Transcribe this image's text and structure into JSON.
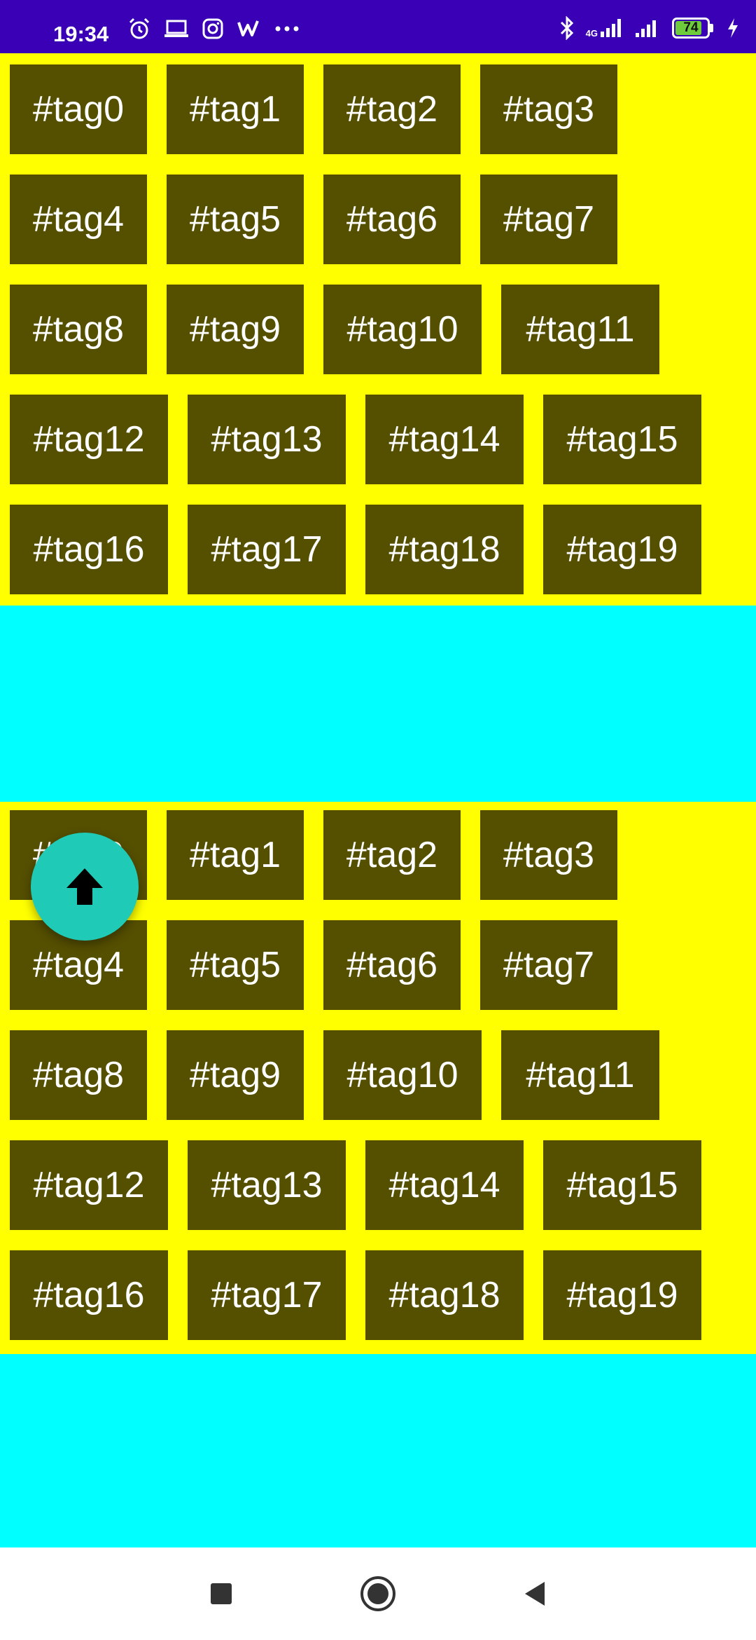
{
  "status_bar": {
    "time": "19:34",
    "left_icons": [
      "alarm-icon",
      "laptop-icon",
      "instagram-icon",
      "w-app-icon",
      "more-icon"
    ],
    "network_label": "4G",
    "battery_level": "74",
    "color": "#3a00b6"
  },
  "tag_blocks": [
    {
      "rows": [
        [
          "#tag0",
          "#tag1",
          "#tag2",
          "#tag3"
        ],
        [
          "#tag4",
          "#tag5",
          "#tag6",
          "#tag7"
        ],
        [
          "#tag8",
          "#tag9",
          "#tag10",
          "#tag11"
        ],
        [
          "#tag12",
          "#tag13",
          "#tag14",
          "#tag15"
        ],
        [
          "#tag16",
          "#tag17",
          "#tag18",
          "#tag19"
        ]
      ]
    },
    {
      "rows": [
        [
          "#tag0",
          "#tag1",
          "#tag2",
          "#tag3"
        ],
        [
          "#tag4",
          "#tag5",
          "#tag6",
          "#tag7"
        ],
        [
          "#tag8",
          "#tag9",
          "#tag10",
          "#tag11"
        ],
        [
          "#tag12",
          "#tag13",
          "#tag14",
          "#tag15"
        ],
        [
          "#tag16",
          "#tag17",
          "#tag18",
          "#tag19"
        ]
      ]
    }
  ],
  "colors": {
    "tag_background": "#554f00",
    "block_background": "#ffff00",
    "band_background": "#00ffff",
    "fab": "#1fcbb6"
  },
  "fab": {
    "icon": "arrow-up-icon"
  },
  "nav_bar": {
    "buttons": [
      "recents-square-icon",
      "home-circle-icon",
      "back-triangle-icon"
    ]
  }
}
